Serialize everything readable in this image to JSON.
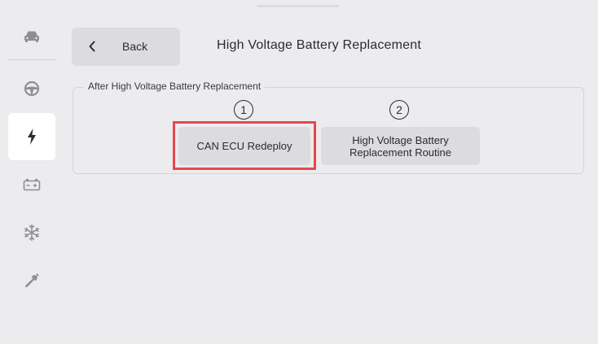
{
  "header": {
    "back_label": "Back",
    "title": "High Voltage Battery Replacement"
  },
  "sidebar": {
    "items": [
      {
        "name": "car-icon",
        "active": false
      },
      {
        "name": "steering-wheel-icon",
        "active": false
      },
      {
        "name": "lightning-bolt-icon",
        "active": true
      },
      {
        "name": "battery-icon",
        "active": false
      },
      {
        "name": "snowflake-icon",
        "active": false
      },
      {
        "name": "wrench-icon",
        "active": false
      }
    ]
  },
  "section": {
    "legend": "After High Voltage Battery Replacement",
    "steps": [
      {
        "number": "1",
        "label": "CAN ECU Redeploy",
        "highlighted": true
      },
      {
        "number": "2",
        "label": "High Voltage Battery Replacement Routine",
        "highlighted": false
      }
    ]
  },
  "colors": {
    "background": "#ececee",
    "button": "#dcdcde",
    "active_tab": "#ffffff",
    "icon": "#8e8e93",
    "highlight": "#e5484d"
  }
}
